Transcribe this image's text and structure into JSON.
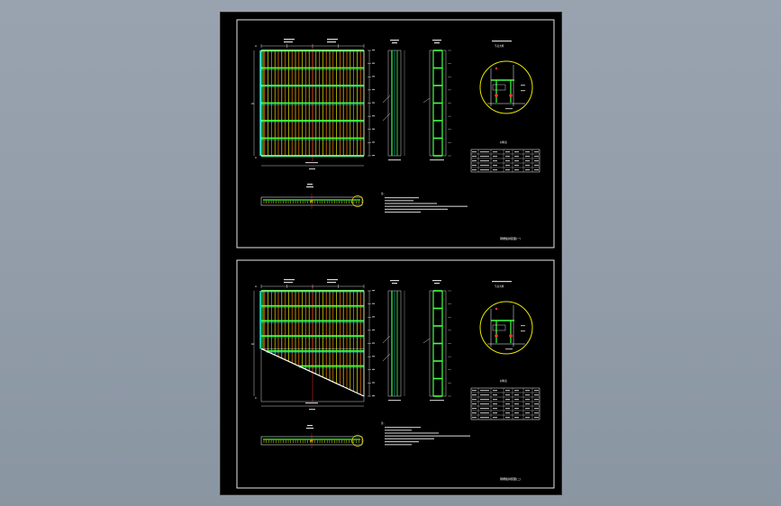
{
  "colors": {
    "background": "#96a0ad",
    "sheet": "#000000",
    "frame": "#ffffff",
    "green": "#22dd22",
    "bright_green": "#44ff44",
    "cyan": "#00dddd",
    "yellow": "#e8e800",
    "orange": "#ff8800",
    "red": "#ff3333",
    "text": "#ffffff"
  },
  "panels": [
    {
      "id": "upper",
      "plan_shape": "rectangle",
      "title_block_text": "钢栅板拼装图(一)",
      "notes_heading": "注:",
      "table_heading": "材料表",
      "detail_heading": "节点大样"
    },
    {
      "id": "lower",
      "plan_shape": "trapezoid",
      "title_block_text": "钢栅板拼装图(二)",
      "notes_heading": "注:",
      "table_heading": "材料表",
      "detail_heading": "节点大样"
    }
  ]
}
